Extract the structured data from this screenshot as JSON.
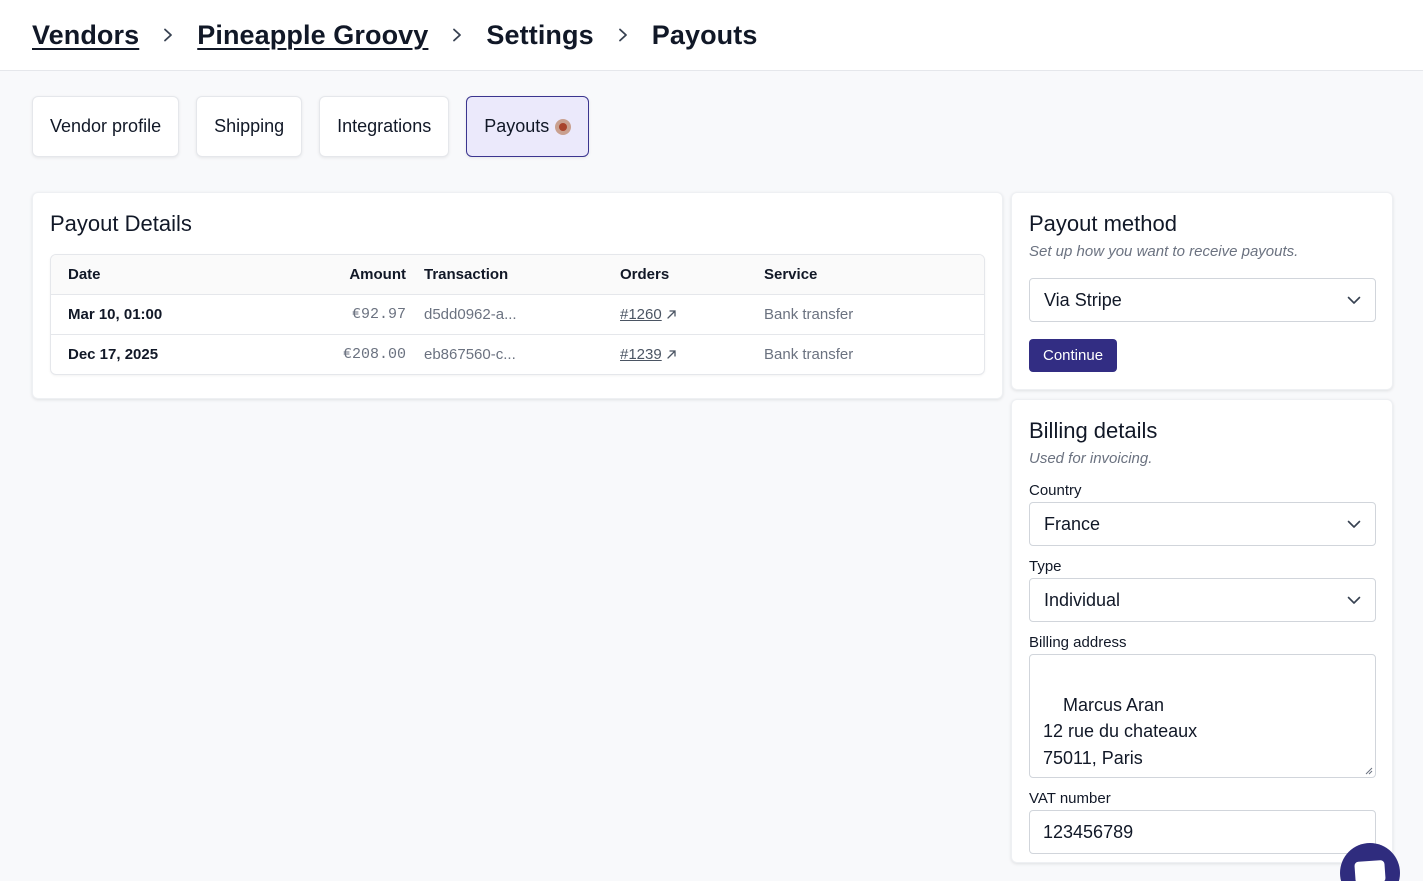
{
  "breadcrumb": [
    {
      "label": "Vendors",
      "link": true
    },
    {
      "label": "Pineapple Groovy",
      "link": true
    },
    {
      "label": "Settings",
      "link": false
    },
    {
      "label": "Payouts",
      "link": false
    }
  ],
  "tabs": [
    {
      "label": "Vendor profile",
      "active": false
    },
    {
      "label": "Shipping",
      "active": false
    },
    {
      "label": "Integrations",
      "active": false
    },
    {
      "label": "Payouts",
      "active": true
    }
  ],
  "payout_details": {
    "title": "Payout Details",
    "columns": [
      "Date",
      "Amount",
      "Transaction",
      "Orders",
      "Service"
    ],
    "rows": [
      {
        "date": "Mar 10, 01:00",
        "amount": "€92.97",
        "transaction": "d5dd0962-a...",
        "order": "#1260",
        "service": "Bank transfer"
      },
      {
        "date": "Dec 17, 2025",
        "amount": "€208.00",
        "transaction": "eb867560-c...",
        "order": "#1239",
        "service": "Bank transfer"
      }
    ]
  },
  "payout_method": {
    "title": "Payout method",
    "subtitle": "Set up how you want to receive payouts.",
    "selected": "Via Stripe",
    "continue_label": "Continue"
  },
  "billing": {
    "title": "Billing details",
    "subtitle": "Used for invoicing.",
    "country_label": "Country",
    "country_value": "France",
    "type_label": "Type",
    "type_value": "Individual",
    "address_label": "Billing address",
    "address_value": "Marcus Aran\n12 rue du chateaux\n75011, Paris",
    "vat_label": "VAT number",
    "vat_value": "123456789"
  },
  "colors": {
    "accent": "#322d83",
    "active_tab_bg": "#ebe9fb",
    "status_dot": "#a8432b"
  },
  "icons": {
    "breadcrumb_separator": "chevron-right-icon",
    "select_caret": "chevron-down-icon",
    "order_link": "external-link-icon",
    "chat": "chat-icon"
  }
}
